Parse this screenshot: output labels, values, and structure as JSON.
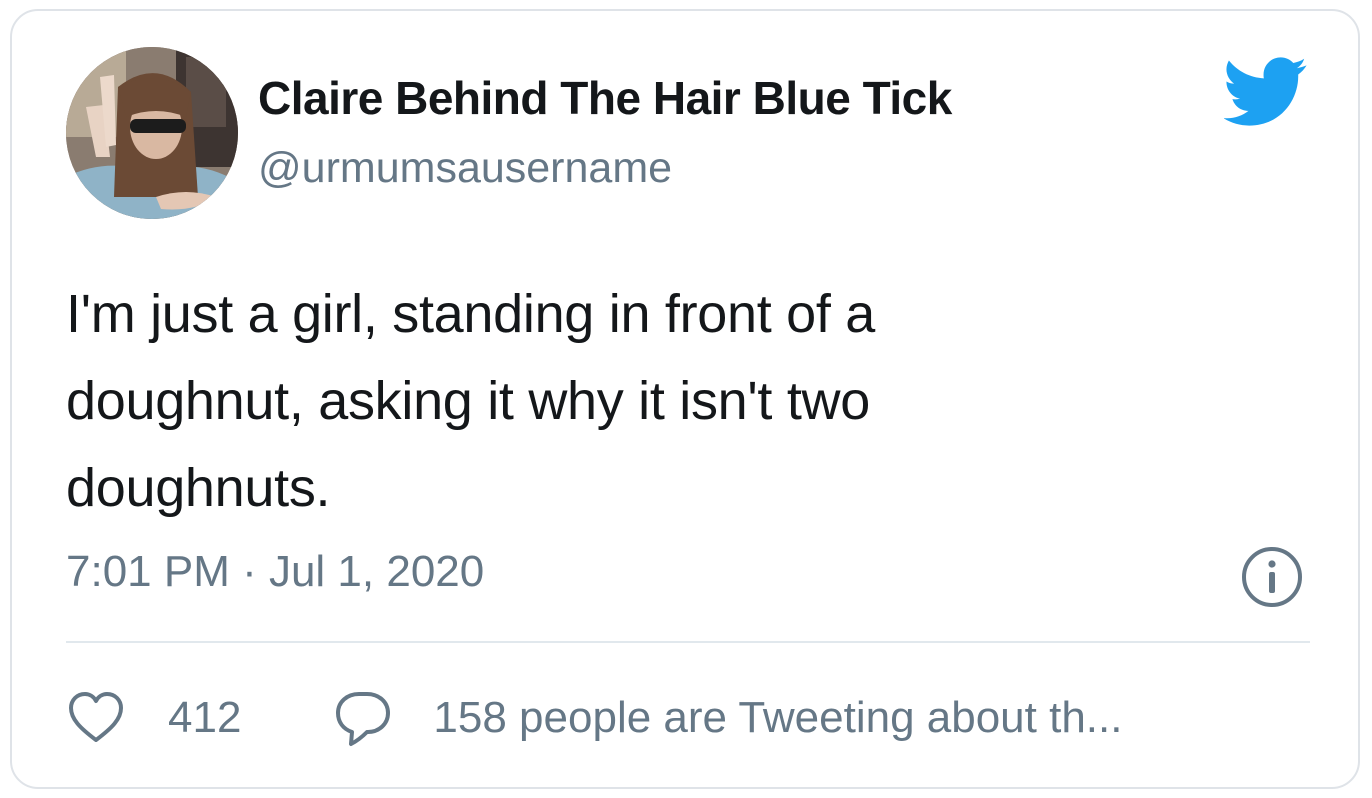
{
  "tweet": {
    "author": {
      "display_name": "Claire Behind The Hair Blue Tick",
      "handle": "@urmumsausername"
    },
    "text": "I'm just a girl, standing in front of a doughnut, asking it why it isn't two doughnuts.",
    "timestamp": "7:01 PM · Jul 1, 2020",
    "likes": "412",
    "conversation": "158 people are Tweeting about th..."
  },
  "icons": {
    "logo": "twitter-bird-icon",
    "info": "info-icon",
    "like": "heart-icon",
    "reply": "speech-bubble-icon"
  },
  "colors": {
    "brand": "#1da1f2",
    "text": "#14171a",
    "secondary": "#657786",
    "border": "#dfe3e8"
  }
}
